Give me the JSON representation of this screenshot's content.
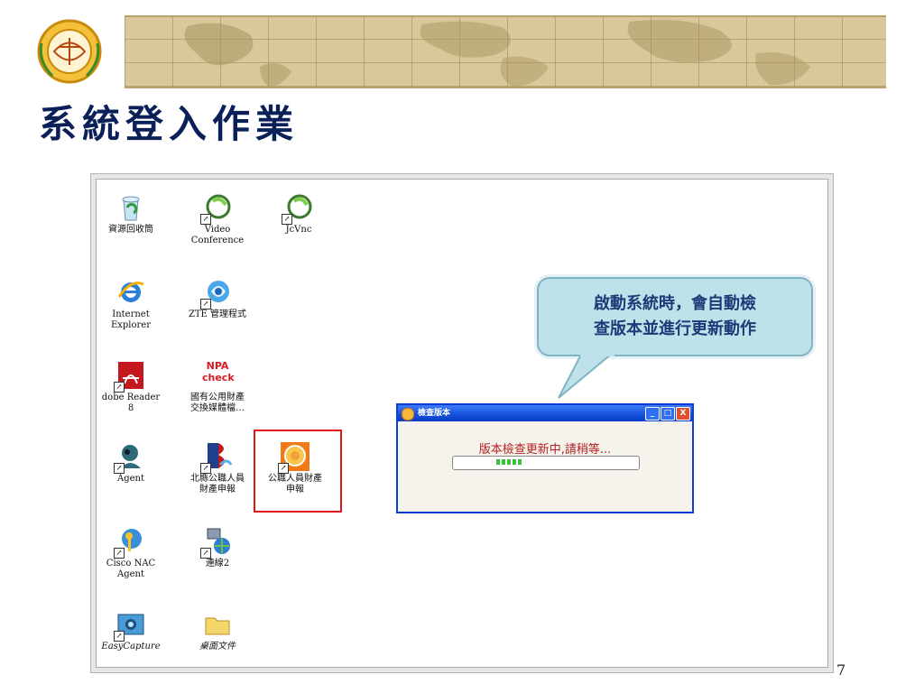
{
  "slide": {
    "title": "系統登入作業",
    "page_number": "7"
  },
  "desktop": {
    "icons": [
      {
        "name": "recycle-bin",
        "label": "資源回收筒",
        "icon": "recycle-bin-icon"
      },
      {
        "name": "video-conference",
        "label": "Video\nConference",
        "icon": "app-swirl-icon"
      },
      {
        "name": "jcvnc",
        "label": "JcVnc",
        "icon": "app-swirl-icon"
      },
      {
        "name": "internet-explorer",
        "label": "Internet\nExplorer",
        "icon": "ie-icon"
      },
      {
        "name": "zte-manager",
        "label": "ZTE 管理程式",
        "icon": "zte-icon"
      },
      {
        "name": "adobe-reader",
        "label": "dobe Reader\n8",
        "icon": "adobe-reader-icon"
      },
      {
        "name": "npa-check",
        "label": "國有公用財產\n交換媒體檔…",
        "icon": "npa-check-icon",
        "icon_text": "NPA\ncheck"
      },
      {
        "name": "agent",
        "label": "Agent",
        "icon": "agent-icon"
      },
      {
        "name": "north-county-declaration",
        "label": "北縣公職人員\n財產申報",
        "icon": "b-logo-icon"
      },
      {
        "name": "official-property-declaration",
        "label": "公職人員財產\n申報",
        "icon": "emblem-icon"
      },
      {
        "name": "cisco-nac",
        "label": "Cisco NAC\nAgent",
        "icon": "cisco-key-icon"
      },
      {
        "name": "connection2",
        "label": "連線2",
        "icon": "network-icon"
      },
      {
        "name": "easycapture",
        "label": "EasyCapture",
        "icon": "camera-icon"
      },
      {
        "name": "desktop-files",
        "label": "桌面文件",
        "icon": "folder-icon"
      }
    ]
  },
  "callout": {
    "line1": "啟動系統時，會自動檢",
    "line2": "查版本並進行更新動作"
  },
  "dialog": {
    "title": "檢查版本",
    "message": "版本檢查更新中,請稍等...",
    "progress_blocks": 5,
    "buttons": {
      "minimize": "_",
      "maximize": "□",
      "close": "X"
    }
  }
}
